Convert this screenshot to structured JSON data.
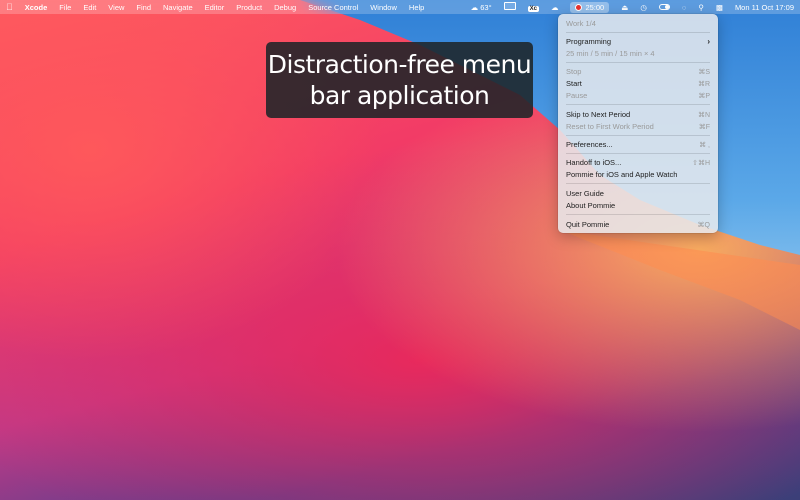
{
  "menubar": {
    "app_name": "Xcode",
    "menus": [
      "File",
      "Edit",
      "View",
      "Find",
      "Navigate",
      "Editor",
      "Product",
      "Debug",
      "Source Control",
      "Window",
      "Help"
    ],
    "status": {
      "weather": "63°",
      "xcode_badge": "Xc",
      "timer": "25:00",
      "datetime": "Mon 11 Oct  17:09"
    }
  },
  "caption": {
    "line1": "Distraction-free menu",
    "line2": "bar application"
  },
  "menu": {
    "header": "Work 1/4",
    "programming": "Programming",
    "durations": "25 min / 5 min / 15 min × 4",
    "stop": {
      "label": "Stop",
      "shortcut": "⌘S"
    },
    "start": {
      "label": "Start",
      "shortcut": "⌘R"
    },
    "pause": {
      "label": "Pause",
      "shortcut": "⌘P"
    },
    "skip": {
      "label": "Skip to Next Period",
      "shortcut": "⌘N"
    },
    "reset": {
      "label": "Reset to First Work Period",
      "shortcut": "⌘F"
    },
    "preferences": {
      "label": "Preferences...",
      "shortcut": "⌘ ,"
    },
    "handoff": {
      "label": "Handoff to iOS...",
      "shortcut": "⇧⌘H"
    },
    "pommie_ios": "Pommie for iOS and Apple Watch",
    "user_guide": "User Guide",
    "about": "About Pommie",
    "quit": {
      "label": "Quit Pommie",
      "shortcut": "⌘Q"
    }
  }
}
